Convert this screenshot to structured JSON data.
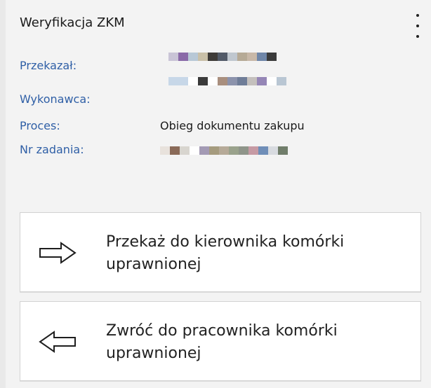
{
  "panel": {
    "title": "Weryfikacja ZKM"
  },
  "fields": {
    "forwarded_by_label": "Przekazał:",
    "executor_label": "Wykonawca:",
    "process_label": "Proces:",
    "process_value": "Obieg dokumentu zakupu",
    "task_no_label": "Nr zadania:"
  },
  "actions": {
    "forward": "Przekaż do kierownika komórki uprawnionej",
    "return": "Zwróć do pracownika komórki uprawnionej"
  },
  "icons": {
    "menu": "kebab-menu-icon",
    "forward": "arrow-right-icon",
    "return": "arrow-left-icon"
  }
}
